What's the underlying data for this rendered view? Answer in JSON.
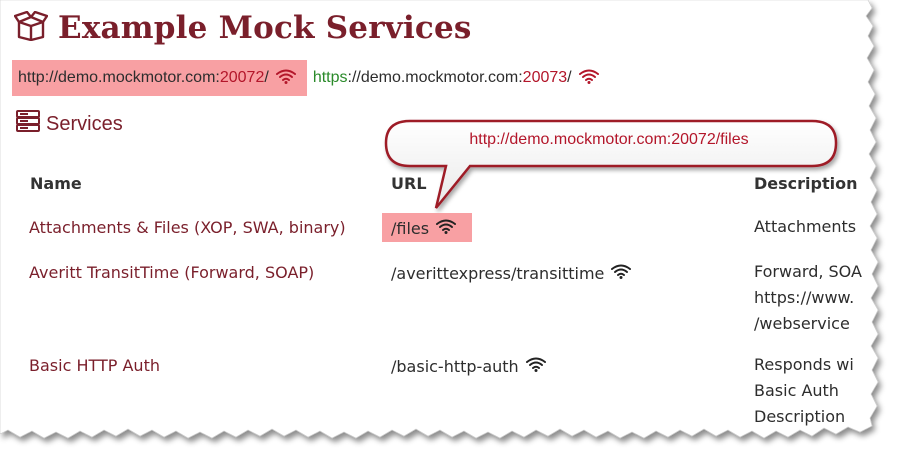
{
  "header": {
    "title": "Example Mock Services",
    "box_icon": "box-open-icon"
  },
  "base_urls": {
    "http": {
      "prefix": "http://demo.mockmotor.com:",
      "port": "20072",
      "suffix": "/",
      "icon": "wifi-icon"
    },
    "https": {
      "scheme": "https",
      "rest": "://demo.mockmotor.com:",
      "port": "20073",
      "suffix": "/",
      "icon": "wifi-icon"
    }
  },
  "services": {
    "heading": "Services",
    "icon": "server-icon"
  },
  "callout": {
    "text": "http://demo.mockmotor.com:20072/files"
  },
  "table": {
    "headers": {
      "name": "Name",
      "url": "URL",
      "description": "Description"
    },
    "rows": [
      {
        "name": "Attachments & Files (XOP, SWA, binary)",
        "url": "/files",
        "description": [
          "Attachments"
        ]
      },
      {
        "name": "Averitt TransitTime (Forward, SOAP)",
        "url": "/averittexpress/transittime",
        "description": [
          "Forward, SOA",
          "https://www.",
          "/webservice"
        ]
      },
      {
        "name": "Basic HTTP Auth",
        "url": "/basic-http-auth",
        "description": [
          "Responds wi",
          "Basic Auth",
          "Description"
        ]
      }
    ]
  },
  "colors": {
    "brand": "#7a1f2b",
    "highlight": "#f8a0a3",
    "port": "#b3162a",
    "https_scheme": "#2a8a2a"
  }
}
